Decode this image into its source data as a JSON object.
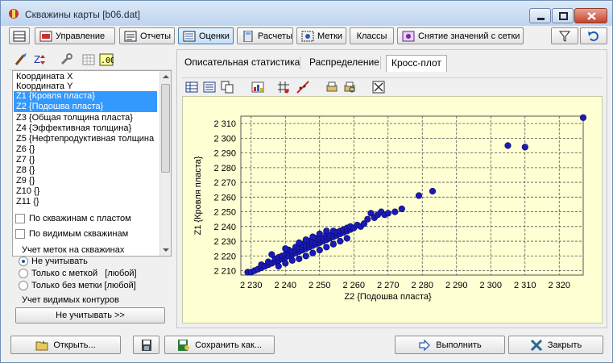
{
  "window": {
    "title": "Скважины карты [b06.dat]"
  },
  "toolbar": {
    "items": [
      {
        "label": ""
      },
      {
        "label": "Управление"
      },
      {
        "label": "Отчеты"
      },
      {
        "label": "Оценки"
      },
      {
        "label": "Расчеты"
      },
      {
        "label": "Метки"
      },
      {
        "label": "Классы"
      },
      {
        "label": "Снятие значений с сетки"
      }
    ]
  },
  "fields": [
    "Координата X",
    "Координата Y",
    "Z1 {Кровля пласта}",
    "Z2 {Подошва пласта}",
    "Z3 {Общая толщина пласта}",
    "Z4 {Эффективная толщина}",
    "Z5 {Нефтепродуктивная толщина",
    "Z6 {}",
    "Z7 {}",
    "Z8 {}",
    "Z9 {}",
    "Z10 {}",
    "Z11 {}"
  ],
  "filters": {
    "by_wells_with_layer": "По скважинам с пластом",
    "by_visible_wells": "По видимым скважинам"
  },
  "marks": {
    "title": "Учет меток на скважинах",
    "options": [
      "Не учитывать",
      "Только с меткой   [любой]",
      "Только без метки [любой]"
    ],
    "selected": 0
  },
  "contours": {
    "title": "Учет видимых контуров",
    "button": "Не учитывать >>"
  },
  "tabs": [
    {
      "label": "Описательная статистика"
    },
    {
      "label": "Распределение"
    },
    {
      "label": "Кросс-плот"
    }
  ],
  "chart_data": {
    "type": "scatter",
    "xlabel": "Z2 {Подошва пласта}",
    "ylabel": "Z1 {Кровля пласта}",
    "xlim": [
      2227,
      2327
    ],
    "ylim": [
      2207,
      2315
    ],
    "xticks": [
      2230,
      2240,
      2250,
      2260,
      2270,
      2280,
      2290,
      2300,
      2310,
      2320
    ],
    "yticks": [
      2210,
      2220,
      2230,
      2240,
      2250,
      2260,
      2270,
      2280,
      2290,
      2300,
      2310
    ],
    "xtick_labels": [
      "2 230",
      "2 240",
      "2 250",
      "2 260",
      "2 270",
      "2 280",
      "2 290",
      "2 300",
      "2 310",
      "2 320"
    ],
    "ytick_labels": [
      "2 210",
      "2 220",
      "2 230",
      "2 240",
      "2 250",
      "2 260",
      "2 270",
      "2 280",
      "2 290",
      "2 300",
      "2 310"
    ],
    "grid": true,
    "marker_color": "#1a1ab8",
    "points": [
      [
        2229,
        2209
      ],
      [
        2230,
        2209
      ],
      [
        2231,
        2210
      ],
      [
        2232,
        2211
      ],
      [
        2233,
        2212
      ],
      [
        2233,
        2214
      ],
      [
        2234,
        2213
      ],
      [
        2235,
        2214
      ],
      [
        2235,
        2216
      ],
      [
        2236,
        2215
      ],
      [
        2237,
        2216
      ],
      [
        2237,
        2218
      ],
      [
        2238,
        2217
      ],
      [
        2238,
        2219
      ],
      [
        2239,
        2218
      ],
      [
        2239,
        2220
      ],
      [
        2240,
        2219
      ],
      [
        2240,
        2221
      ],
      [
        2241,
        2220
      ],
      [
        2241,
        2222
      ],
      [
        2241,
        2224
      ],
      [
        2242,
        2221
      ],
      [
        2242,
        2223
      ],
      [
        2243,
        2222
      ],
      [
        2243,
        2224
      ],
      [
        2243,
        2226
      ],
      [
        2244,
        2223
      ],
      [
        2244,
        2225
      ],
      [
        2245,
        2224
      ],
      [
        2245,
        2226
      ],
      [
        2245,
        2228
      ],
      [
        2246,
        2225
      ],
      [
        2246,
        2227
      ],
      [
        2247,
        2226
      ],
      [
        2247,
        2228
      ],
      [
        2247,
        2230
      ],
      [
        2248,
        2227
      ],
      [
        2248,
        2229
      ],
      [
        2249,
        2228
      ],
      [
        2249,
        2230
      ],
      [
        2249,
        2232
      ],
      [
        2250,
        2229
      ],
      [
        2250,
        2231
      ],
      [
        2250,
        2233
      ],
      [
        2251,
        2230
      ],
      [
        2251,
        2232
      ],
      [
        2252,
        2231
      ],
      [
        2252,
        2233
      ],
      [
        2252,
        2235
      ],
      [
        2253,
        2232
      ],
      [
        2253,
        2234
      ],
      [
        2254,
        2233
      ],
      [
        2254,
        2235
      ],
      [
        2254,
        2237
      ],
      [
        2255,
        2234
      ],
      [
        2255,
        2236
      ],
      [
        2256,
        2235
      ],
      [
        2256,
        2237
      ],
      [
        2257,
        2236
      ],
      [
        2257,
        2238
      ],
      [
        2258,
        2237
      ],
      [
        2258,
        2239
      ],
      [
        2259,
        2238
      ],
      [
        2259,
        2240
      ],
      [
        2260,
        2239
      ],
      [
        2261,
        2241
      ],
      [
        2262,
        2240
      ],
      [
        2263,
        2242
      ],
      [
        2264,
        2245
      ],
      [
        2265,
        2249
      ],
      [
        2266,
        2246
      ],
      [
        2267,
        2248
      ],
      [
        2268,
        2250
      ],
      [
        2269,
        2248
      ],
      [
        2270,
        2249
      ],
      [
        2272,
        2250
      ],
      [
        2274,
        2252
      ],
      [
        2279,
        2261
      ],
      [
        2283,
        2264
      ],
      [
        2305,
        2295
      ],
      [
        2310,
        2294
      ],
      [
        2327,
        2314
      ],
      [
        2240,
        2215
      ],
      [
        2244,
        2218
      ],
      [
        2248,
        2222
      ],
      [
        2252,
        2226
      ],
      [
        2256,
        2230
      ],
      [
        2236,
        2221
      ],
      [
        2240,
        2225
      ],
      [
        2244,
        2229
      ],
      [
        2248,
        2233
      ],
      [
        2252,
        2237
      ],
      [
        2246,
        2220
      ],
      [
        2250,
        2224
      ],
      [
        2254,
        2228
      ],
      [
        2258,
        2232
      ],
      [
        2238,
        2213
      ],
      [
        2242,
        2217
      ],
      [
        2246,
        2231
      ],
      [
        2250,
        2235
      ]
    ]
  },
  "bottom": {
    "open": "Открыть...",
    "save_as": "Сохранить как...",
    "run": "Выполнить",
    "close": "Закрыть"
  }
}
